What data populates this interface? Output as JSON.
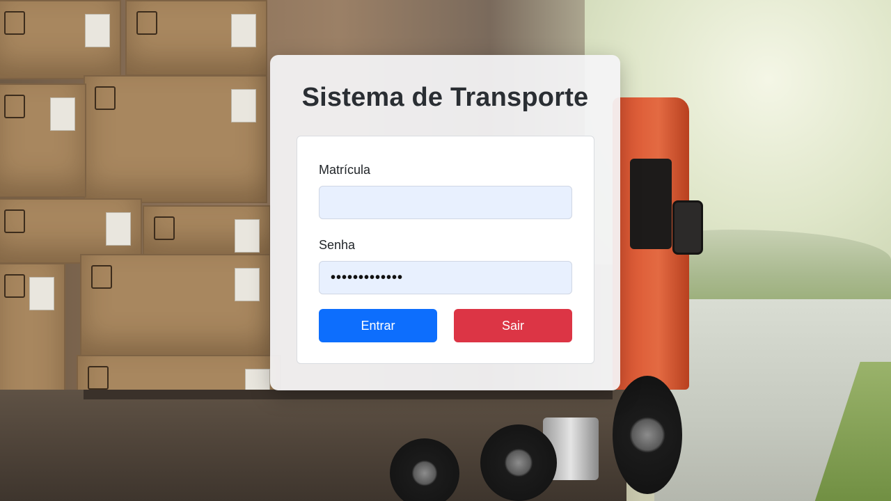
{
  "page": {
    "background_description": ""
  },
  "login": {
    "title": "Sistema de Transporte",
    "matricula_label": "Matrícula",
    "matricula_value": "",
    "senha_label": "Senha",
    "senha_value": "•••••••••••••",
    "entrar_label": "Entrar",
    "sair_label": "Sair"
  },
  "colors": {
    "primary": "#0d6efd",
    "danger": "#dc3545",
    "input_bg": "#e8f0fe",
    "title": "#2a2e33"
  }
}
